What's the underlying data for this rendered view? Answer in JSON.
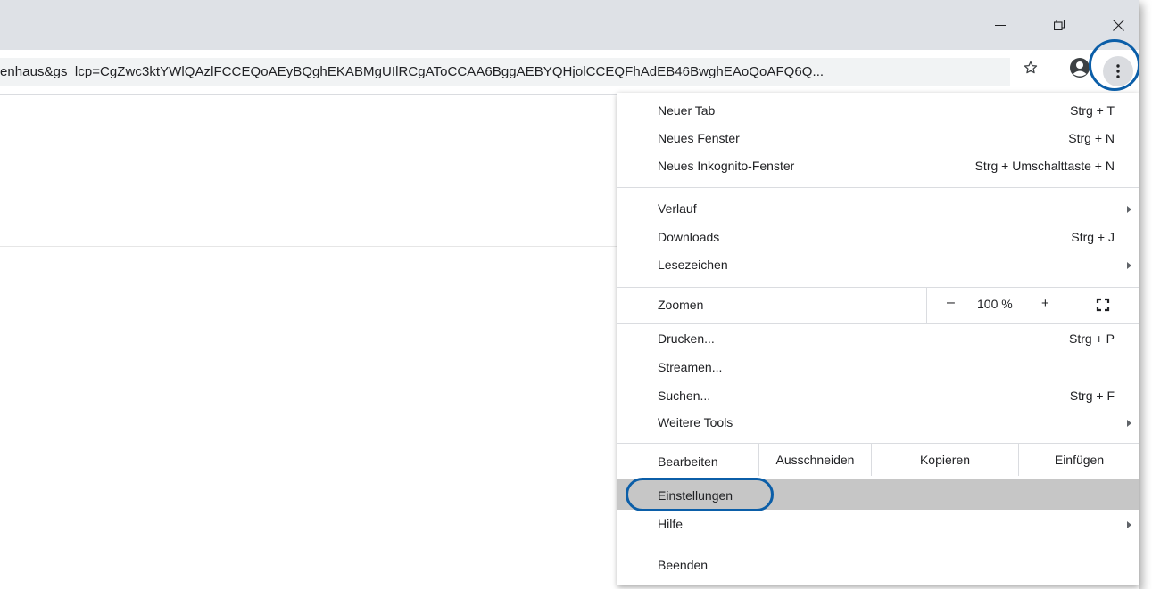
{
  "window": {
    "minimize_icon": "minimize-icon",
    "restore_icon": "restore-icon",
    "close_icon": "close-icon"
  },
  "toolbar": {
    "url": "enhaus&gs_lcp=CgZwc3ktYWlQAzlFCCEQoAEyBQghEKABMgUIlRCgAToCCAA6BggAEBYQHjolCCEQFhAdEB46BwghEAoQoAFQ6Q...",
    "star_icon": "bookmark-star-icon",
    "profile_icon": "profile-avatar-icon",
    "menu_icon": "kebab-menu-icon"
  },
  "menu": {
    "new_tab": {
      "label": "Neuer Tab",
      "shortcut": "Strg + T"
    },
    "new_window": {
      "label": "Neues Fenster",
      "shortcut": "Strg + N"
    },
    "new_incognito": {
      "label": "Neues Inkognito-Fenster",
      "shortcut": "Strg + Umschalttaste + N"
    },
    "history": {
      "label": "Verlauf"
    },
    "downloads": {
      "label": "Downloads",
      "shortcut": "Strg + J"
    },
    "bookmarks": {
      "label": "Lesezeichen"
    },
    "zoom": {
      "label": "Zoomen",
      "minus": "–",
      "value": "100 %",
      "plus": "+"
    },
    "print": {
      "label": "Drucken...",
      "shortcut": "Strg + P"
    },
    "cast": {
      "label": "Streamen..."
    },
    "find": {
      "label": "Suchen...",
      "shortcut": "Strg + F"
    },
    "more_tools": {
      "label": "Weitere Tools"
    },
    "edit": {
      "label": "Bearbeiten",
      "cut": "Ausschneiden",
      "copy": "Kopieren",
      "paste": "Einfügen"
    },
    "settings": {
      "label": "Einstellungen"
    },
    "help": {
      "label": "Hilfe"
    },
    "exit": {
      "label": "Beenden"
    }
  },
  "colors": {
    "highlight_ring": "#0b5ea8",
    "hover_row": "#c6c6c6"
  }
}
